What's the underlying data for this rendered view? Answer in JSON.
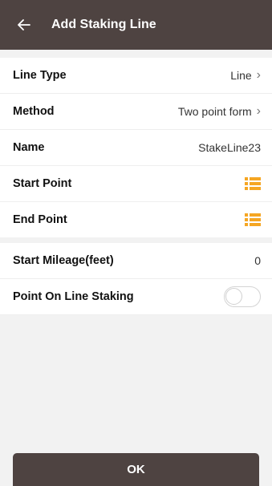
{
  "header": {
    "title": "Add Staking Line",
    "back_icon": "arrow-left-icon"
  },
  "rows": {
    "line_type": {
      "label": "Line Type",
      "value": "Line"
    },
    "method": {
      "label": "Method",
      "value": "Two point form"
    },
    "name": {
      "label": "Name",
      "value": "StakeLine23"
    },
    "start_point": {
      "label": "Start Point",
      "icon": "list-icon"
    },
    "end_point": {
      "label": "End Point",
      "icon": "list-icon"
    },
    "start_mileage": {
      "label": "Start Mileage(feet)",
      "value": "0"
    },
    "point_on_line": {
      "label": "Point On Line Staking",
      "toggle_on": false
    }
  },
  "ok_button": {
    "label": "OK"
  },
  "colors": {
    "header": "#4e4341",
    "accent_icon": "#f5a623"
  }
}
